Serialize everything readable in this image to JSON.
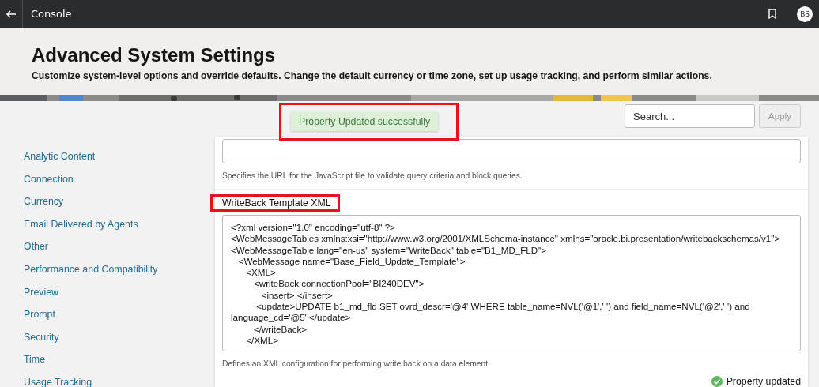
{
  "topbar": {
    "title": "Console",
    "avatar": "BS"
  },
  "header": {
    "title": "Advanced System Settings",
    "subtitle": "Customize system-level options and override defaults. Change the default currency or time zone, set up usage tracking, and perform similar actions."
  },
  "toast": {
    "text": "Property Updated successfully",
    "highlighted": true
  },
  "search": {
    "placeholder": "Search...",
    "button": "Apply",
    "button_disabled": true
  },
  "sidebar": {
    "items": [
      {
        "label": "Analytic Content"
      },
      {
        "label": "Connection"
      },
      {
        "label": "Currency"
      },
      {
        "label": "Email Delivered by Agents"
      },
      {
        "label": "Other"
      },
      {
        "label": "Performance and Compatibility"
      },
      {
        "label": "Preview"
      },
      {
        "label": "Prompt"
      },
      {
        "label": "Security"
      },
      {
        "label": "Time"
      },
      {
        "label": "Usage Tracking"
      }
    ]
  },
  "settings": [
    {
      "kind": "text",
      "description": "Specifies the URL for the JavaScript file to validate query criteria and block queries."
    },
    {
      "kind": "xml",
      "label": "WriteBack Template XML",
      "highlighted": true,
      "value": "<?xml version=\"1.0\" encoding=\"utf-8\" ?>\n<WebMessageTables xmlns:xsi=\"http://www.w3.org/2001/XMLSchema-instance\" xmlns=\"oracle.bi.presentation/writebackschemas/v1\">\n<WebMessageTable lang=\"en-us\" system=\"WriteBack\" table=\"B1_MD_FLD\">\n   <WebMessage name=\"Base_Field_Update_Template\">\n      <XML>\n         <writeBack connectionPool=\"BI240DEV\">\n            <insert> </insert>\n          <update>UPDATE b1_md_fld SET ovrd_descr='@4' WHERE table_name=NVL('@1',' ') and field_name=NVL('@2',' ') and language_cd='@5' </update>\n         </writeBack>\n      </XML>",
      "description": "Defines an XML configuration for performing write back on a data element.",
      "status": "Property updated"
    }
  ]
}
